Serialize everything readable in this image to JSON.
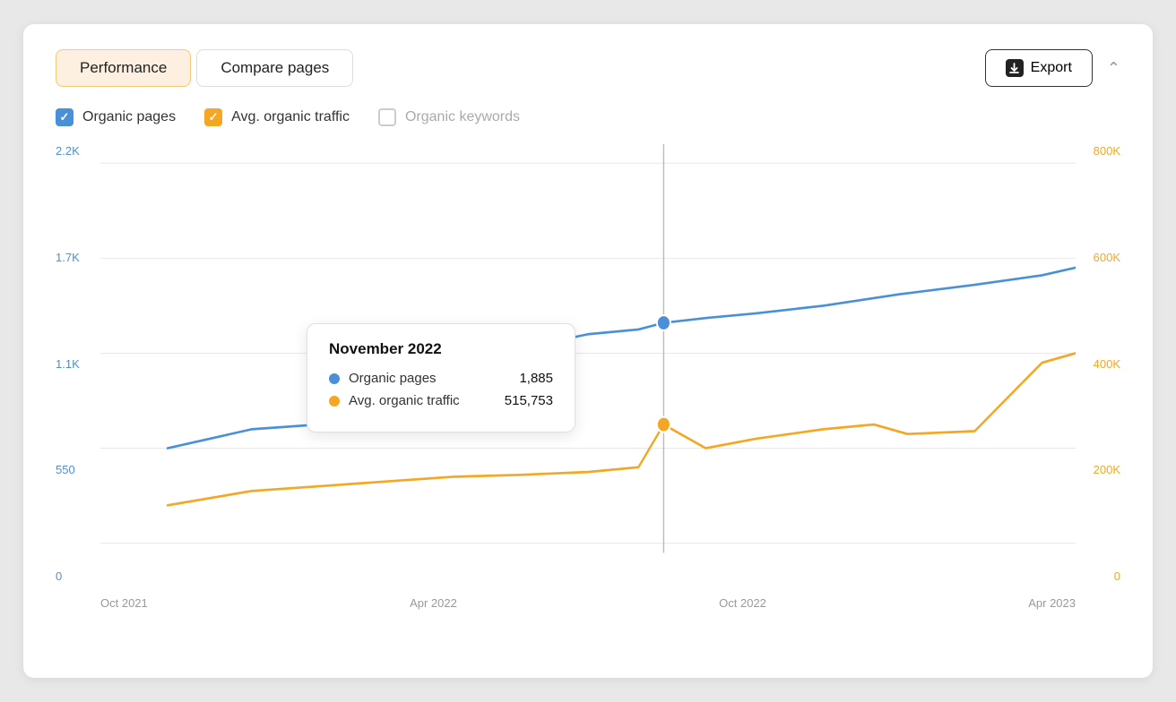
{
  "header": {
    "tabs": [
      {
        "id": "performance",
        "label": "Performance",
        "active": true
      },
      {
        "id": "compare-pages",
        "label": "Compare pages",
        "active": false
      }
    ],
    "export_label": "Export",
    "export_icon": "download-icon",
    "chevron": "chevron-up-icon"
  },
  "legend": {
    "items": [
      {
        "id": "organic-pages",
        "label": "Organic pages",
        "color": "blue",
        "checked": true
      },
      {
        "id": "avg-organic-traffic",
        "label": "Avg. organic traffic",
        "color": "orange",
        "checked": true
      },
      {
        "id": "organic-keywords",
        "label": "Organic keywords",
        "color": "empty",
        "checked": false
      }
    ]
  },
  "chart": {
    "y_axis_left": [
      "2.2K",
      "1.7K",
      "1.1K",
      "550",
      "0"
    ],
    "y_axis_right": [
      "800K",
      "600K",
      "400K",
      "200K",
      "0"
    ],
    "x_axis": [
      "Oct 2021",
      "Apr 2022",
      "Oct 2022",
      "Apr 2023"
    ]
  },
  "tooltip": {
    "title": "November 2022",
    "rows": [
      {
        "label": "Organic pages",
        "value": "1,885",
        "color": "#4a90d9"
      },
      {
        "label": "Avg. organic traffic",
        "value": "515,753",
        "color": "#f5a623"
      }
    ]
  }
}
